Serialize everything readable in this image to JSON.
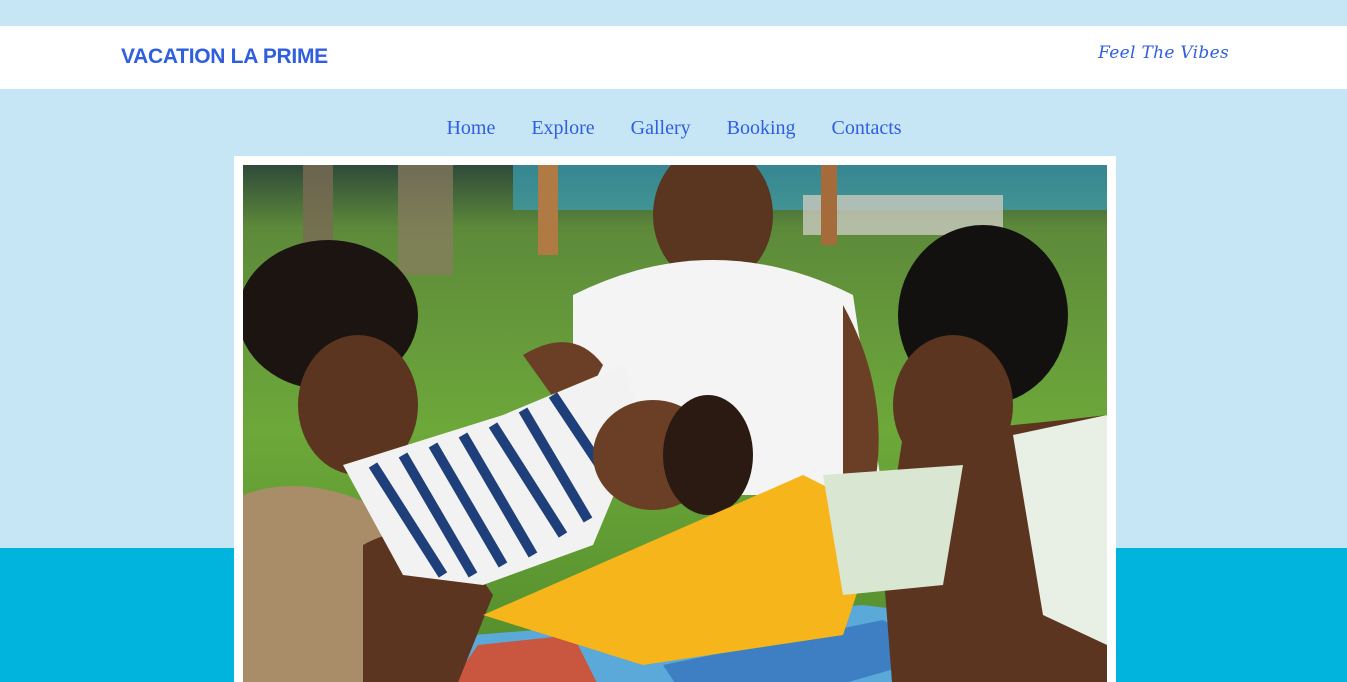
{
  "header": {
    "brand": "VACATION LA PRIME",
    "tagline": "Feel The Vibes"
  },
  "nav": {
    "items": [
      {
        "label": "Home"
      },
      {
        "label": "Explore"
      },
      {
        "label": "Gallery"
      },
      {
        "label": "Booking"
      },
      {
        "label": "Contacts"
      }
    ]
  },
  "hero": {
    "image_subject": "family-picnic-photo"
  },
  "colors": {
    "accent": "#2f5ee0",
    "page_background": "#c7e6f5",
    "lower_band": "#00b4de",
    "header_background": "#ffffff"
  }
}
